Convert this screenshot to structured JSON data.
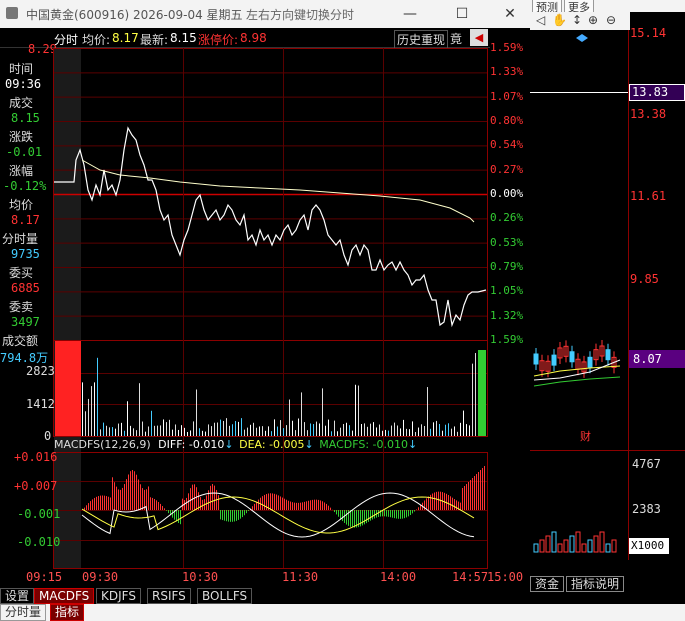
{
  "window": {
    "title": "中国黄金(600916) 2026-09-04 星期五",
    "hint": "左右方向键切换分时",
    "buttons": [
      "—",
      "☐",
      "✕"
    ]
  },
  "toolbar": {
    "mode": "分时",
    "avg_label": "均价:",
    "avg_value": "8.17",
    "latest_label": "最新:",
    "latest_value": "8.15",
    "limit_label": "涨停价:",
    "limit_value": "8.98",
    "history_button": "历史重现",
    "compete_button": "竟"
  },
  "left_info": {
    "top_price": "8.29",
    "time_label": "时间",
    "time_value": "09:36",
    "deal_label": "成交",
    "deal_value": "8.15",
    "change_label": "涨跌",
    "change_value": "-0.01",
    "amp_label": "涨幅",
    "amp_value": "-0.12%",
    "avg_label": "均价",
    "avg_value": "8.17",
    "vol_label": "分时量",
    "vol_value": "9735",
    "buy_label": "委买",
    "buy_value": "6885",
    "sell_label": "委卖",
    "sell_value": "3497",
    "amount_label": "成交额",
    "amount_value": "794.8万"
  },
  "price_chart": {
    "right_axis": [
      "1.59%",
      "1.33%",
      "1.07%",
      "0.80%",
      "0.54%",
      "0.27%",
      "0.00%",
      "0.26%",
      "0.53%",
      "0.79%",
      "1.05%",
      "1.32%",
      "1.59%"
    ]
  },
  "volume_axis": [
    "2823",
    "1412",
    "0"
  ],
  "macd": {
    "header": "MACDFS(12,26,9)",
    "diff_label": "DIFF:",
    "diff_value": "-0.010",
    "dea_label": "DEA:",
    "dea_value": "-0.005",
    "macd_label": "MACDFS:",
    "macd_value": "-0.010",
    "axis": [
      "+0.016",
      "+0.007",
      "-0.001",
      "-0.010"
    ]
  },
  "time_axis": [
    "09:15",
    "09:30",
    "10:30",
    "11:30",
    "14:00",
    "14:57",
    "15:00"
  ],
  "bottom_tabs": [
    "设置",
    "MACDFS",
    "KDJFS",
    "RSIFS",
    "BOLLFS"
  ],
  "bottom_tabs2": [
    "分时量",
    "指标"
  ],
  "right_panel": {
    "tabs": [
      "预测",
      "更多"
    ],
    "price_labels": [
      "15.14",
      "13.38",
      "11.61",
      "9.85"
    ],
    "highlight_price": "13.83",
    "current_price": "8.07",
    "vol_labels": [
      "4767",
      "2383"
    ],
    "multiplier": "X1000",
    "marker": "财",
    "bottom_tabs": [
      "资金",
      "指标说明"
    ]
  },
  "colors": {
    "red": "#ff3333",
    "green": "#33cc33",
    "gridred": "#8b0000",
    "white": "#ffffff",
    "yellow": "#ffff44",
    "cyan": "#44ccff",
    "axisred": "#ff5050"
  }
}
